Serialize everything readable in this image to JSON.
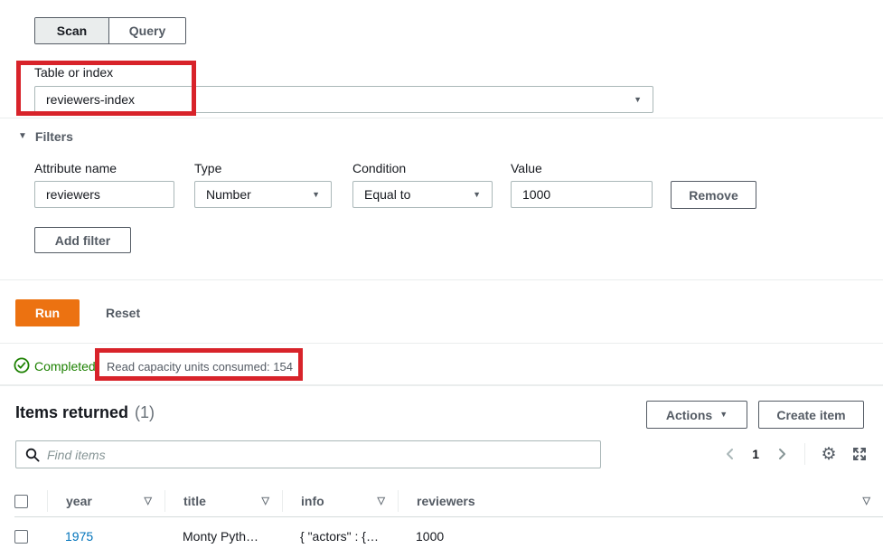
{
  "tabs": {
    "scan": "Scan",
    "query": "Query"
  },
  "table_selector": {
    "label": "Table or index",
    "value": "reviewers-index"
  },
  "filters": {
    "heading": "Filters",
    "labels": {
      "attribute": "Attribute name",
      "type": "Type",
      "condition": "Condition",
      "value": "Value"
    },
    "row": {
      "attribute": "reviewers",
      "type": "Number",
      "condition": "Equal to",
      "value": "1000"
    },
    "remove_label": "Remove",
    "add_filter_label": "Add filter"
  },
  "actions_bar": {
    "run": "Run",
    "reset": "Reset"
  },
  "status": {
    "state": "Completed",
    "detail": "Read capacity units consumed: 154"
  },
  "results": {
    "title": "Items returned",
    "count": "(1)",
    "actions_label": "Actions",
    "create_item_label": "Create item",
    "search_placeholder": "Find items",
    "page": "1"
  },
  "table": {
    "columns": {
      "year": "year",
      "title": "title",
      "info": "info",
      "reviewers": "reviewers"
    },
    "rows": [
      {
        "year": "1975",
        "title": "Monty Pyth…",
        "info": "{ \"actors\" : {…",
        "reviewers": "1000"
      }
    ]
  },
  "colors": {
    "accent_orange": "#ec7211",
    "success_green": "#1d8102",
    "annotation_red": "#d8232a",
    "link_blue": "#0073bb"
  }
}
